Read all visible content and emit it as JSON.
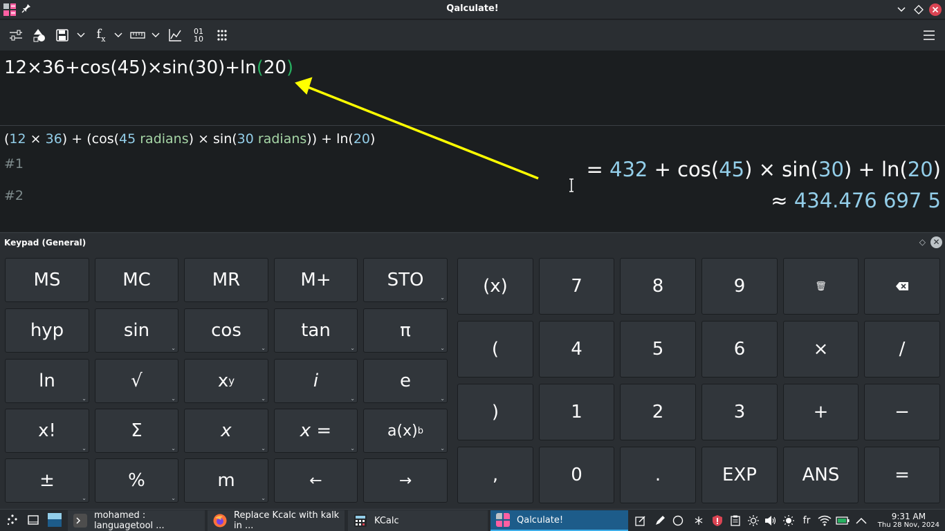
{
  "window": {
    "title": "Qalculate!"
  },
  "expression": {
    "before": "12×36+cos(45)×sin(30)+ln",
    "open": "(",
    "arg": "20",
    "close": ")"
  },
  "parsed": {
    "p1": "(",
    "n1": "12",
    "op1": " × ",
    "n2": "36",
    "p2": ") + (cos(",
    "n3": "45",
    "u1": " radians",
    "p3": ") × sin(",
    "n4": "30",
    "u2": " radians",
    "p4": ")) + ln(",
    "n5": "20",
    "p5": ")"
  },
  "history": {
    "h1": "#1",
    "h2": "#2"
  },
  "result": {
    "e1": "= ",
    "v1": "432",
    "e2": " + cos(",
    "v2": "45",
    "e3": ") × sin(",
    "v3": "30",
    "e4": ") + ln(",
    "v4": "20",
    "e5": ")",
    "approx_sym": "≈ ",
    "approx_val": "434.476 697 5"
  },
  "keypad": {
    "title": "Keypad (General)",
    "left": [
      [
        "MS",
        "MC",
        "MR",
        "M+",
        "STO"
      ],
      [
        "hyp",
        "sin",
        "cos",
        "tan",
        "π"
      ],
      [
        "ln",
        "√",
        "x",
        "i",
        "e"
      ],
      [
        "x!",
        "Σ",
        "x",
        "x =",
        "a(x)"
      ],
      [
        "±",
        "%",
        "m",
        "←",
        "→"
      ]
    ],
    "sup_xy": "y",
    "sup_b": "b",
    "right": [
      [
        "(x)",
        "7",
        "8",
        "9",
        "🗑",
        "⌫"
      ],
      [
        "(",
        "4",
        "5",
        "6",
        "×",
        "/"
      ],
      [
        ")",
        "1",
        "2",
        "3",
        "+",
        "−"
      ],
      [
        ",",
        "0",
        ".",
        "EXP",
        "ANS",
        "="
      ]
    ]
  },
  "taskbar": {
    "tasks": [
      {
        "label": "mohamed : languagetool ...",
        "active": false
      },
      {
        "label": "Replace Kcalc with kalk in ...",
        "active": false
      },
      {
        "label": "KCalc",
        "active": false
      },
      {
        "label": "Qalculate!",
        "active": true
      }
    ],
    "lang": "fr",
    "time": "9:31 AM",
    "date": "Thu 28 Nov, 2024"
  },
  "colors": {
    "accent": "#3daee9",
    "number": "#93cee9",
    "unit": "#a6d6a6",
    "paren_match": "#27ae60",
    "close_button": "#da4453",
    "annotation_arrow": "#ffff00"
  }
}
